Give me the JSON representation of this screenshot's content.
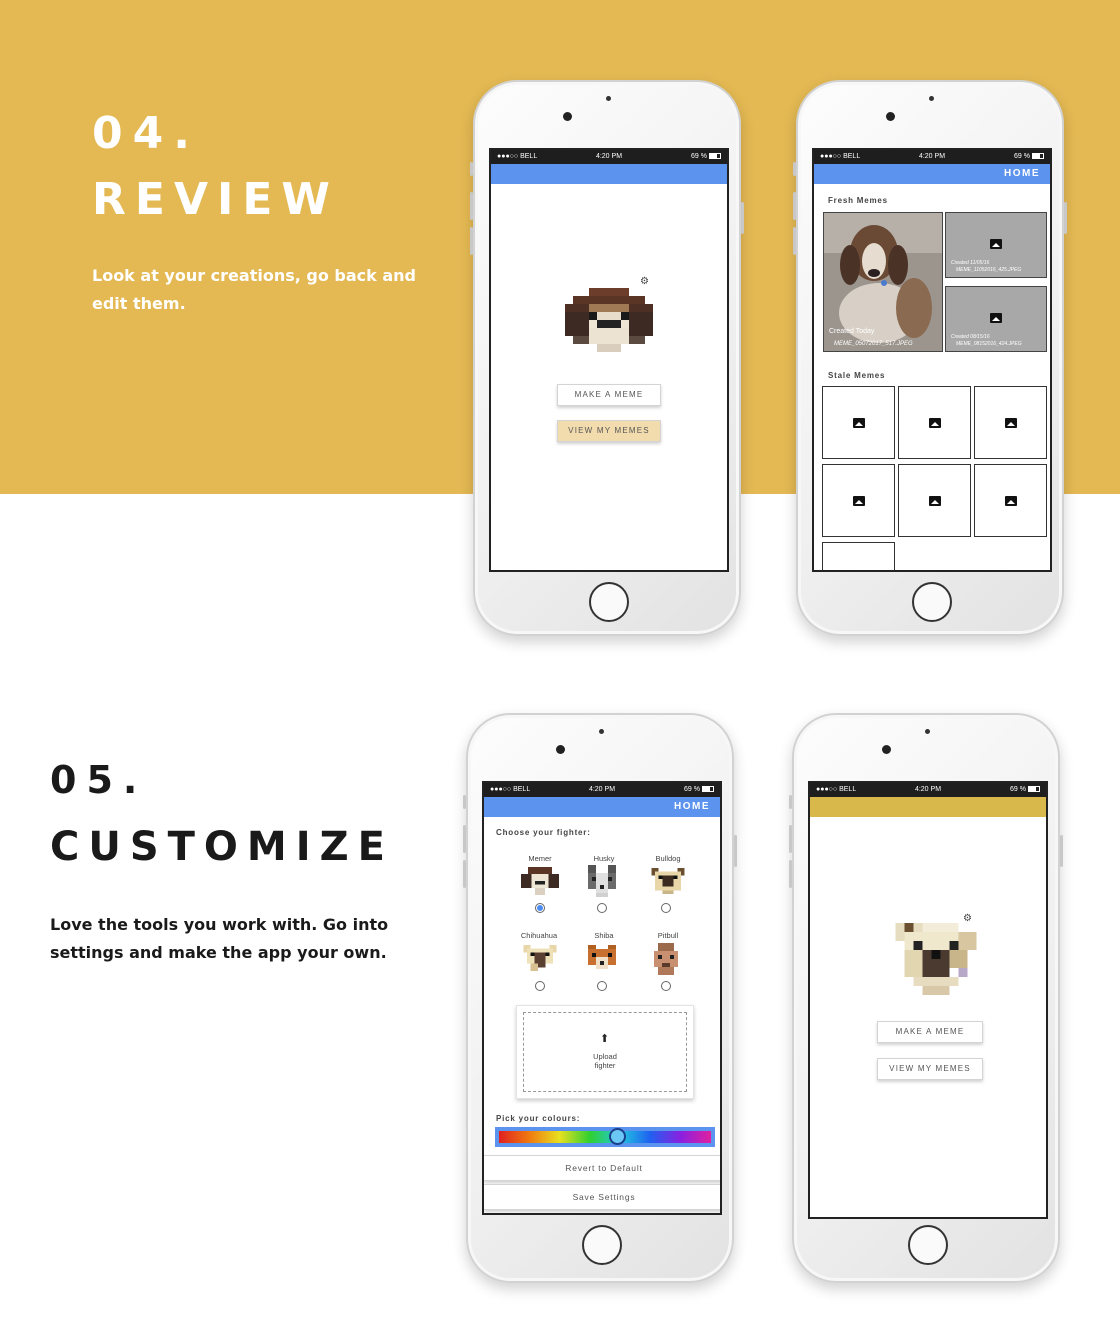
{
  "section4": {
    "number": "04.",
    "title": "REVIEW",
    "description_line1": "Look at your creations, go back and",
    "description_line2": "edit them."
  },
  "section5": {
    "number": "05.",
    "title": "CUSTOMIZE",
    "description_line1": "Love the tools you work with. Go into",
    "description_line2": "settings and make the app your own."
  },
  "status": {
    "carrier": "●●●○○ BELL",
    "time": "4:20 PM",
    "battery": "69 %"
  },
  "home_screen": {
    "make_meme": "MAKE A MEME",
    "view_memes": "VIEW MY MEMES"
  },
  "memes_screen": {
    "home": "HOME",
    "fresh_label": "Fresh Memes",
    "stale_label": "Stale Memes",
    "featured_caption": "Created Today",
    "featured_file": "MEME_05072017_517.JPEG",
    "tile1_created": "Created 11/05/16",
    "tile1_file": "MEME_11052016_425.JPEG",
    "tile2_created": "Created 08/15/16",
    "tile2_file": "MEME_08152016_424.JPEG"
  },
  "settings_screen": {
    "home": "HOME",
    "choose_label": "Choose your fighter:",
    "fighters": [
      "Memer",
      "Husky",
      "Bulldog",
      "Chihuahua",
      "Shiba",
      "Pitbull"
    ],
    "upload_line1": "Upload",
    "upload_line2": "fighter",
    "colours_label": "Pick your colours:",
    "revert": "Revert to Default",
    "save": "Save Settings",
    "hue_position": 0.56
  },
  "colors": {
    "band": "#e4b953",
    "appbar_blue": "#5b93ee",
    "appbar_yellow": "#d9b84b",
    "view_memes_bg": "#f2dcae"
  }
}
